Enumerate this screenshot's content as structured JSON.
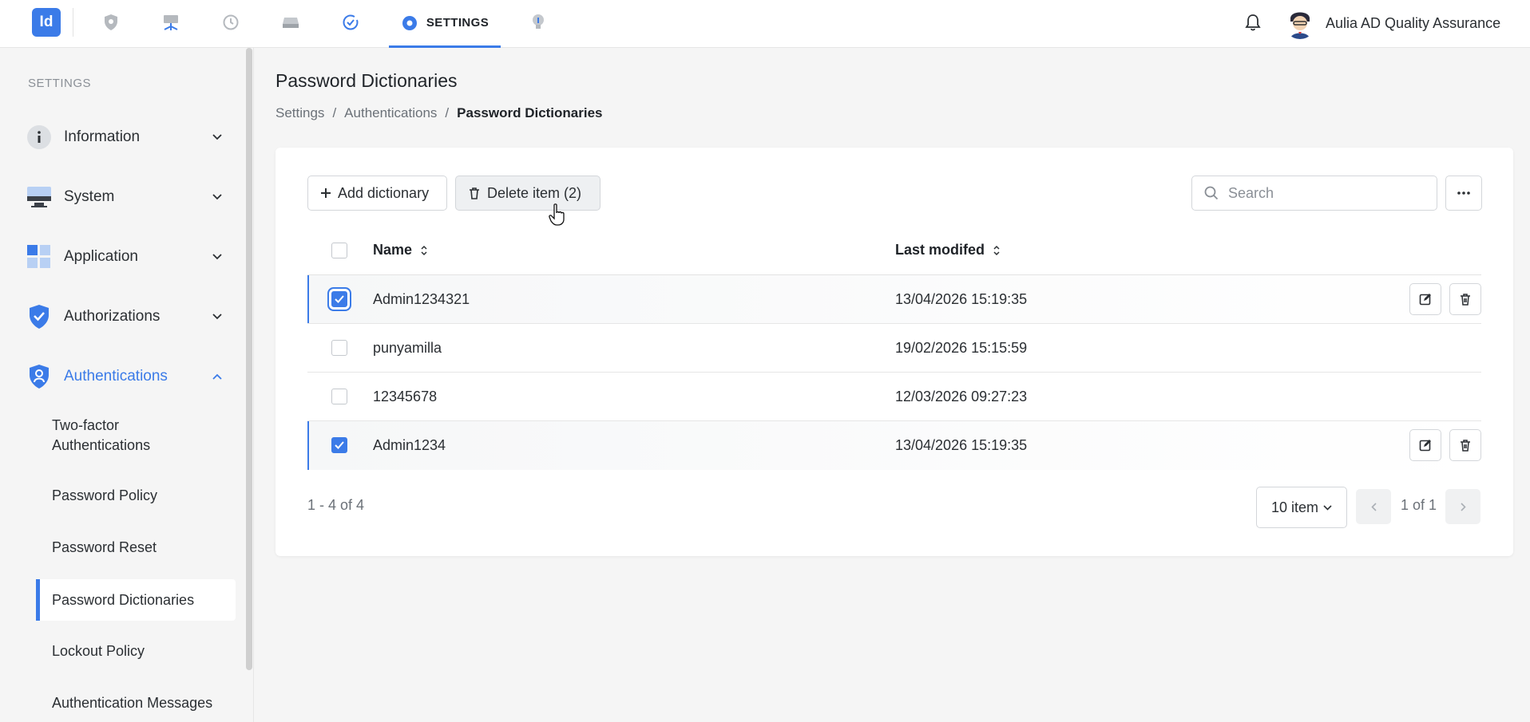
{
  "topbar": {
    "logo": "Id",
    "nav_active_label": "SETTINGS",
    "user_name": "Aulia AD Quality Assurance",
    "nav_icons": [
      "shield-icon",
      "network-icon",
      "history-icon",
      "storage-icon",
      "check-circle-icon",
      "settings-gear-icon",
      "bulb-icon"
    ]
  },
  "sidebar": {
    "title": "SETTINGS",
    "items": [
      {
        "label": "Information",
        "icon": "info-icon"
      },
      {
        "label": "System",
        "icon": "monitor-icon"
      },
      {
        "label": "Application",
        "icon": "grid-icon"
      },
      {
        "label": "Authorizations",
        "icon": "shield-check-icon"
      },
      {
        "label": "Authentications",
        "icon": "shield-user-icon",
        "active": true
      }
    ],
    "subitems": [
      {
        "label": "Two-factor Authentications"
      },
      {
        "label": "Password Policy"
      },
      {
        "label": "Password Reset"
      },
      {
        "label": "Password Dictionaries",
        "active": true
      },
      {
        "label": "Lockout Policy"
      },
      {
        "label": "Authentication Messages"
      }
    ]
  },
  "main": {
    "title": "Password Dictionaries",
    "breadcrumb": [
      "Settings",
      "Authentications",
      "Password Dictionaries"
    ],
    "toolbar": {
      "add_label": "Add dictionary",
      "delete_label": "Delete item (2)",
      "search_placeholder": "Search"
    },
    "table": {
      "columns": [
        "Name",
        "Last modifed"
      ],
      "rows": [
        {
          "name": "Admin1234321",
          "modified": "13/04/2026 15:19:35",
          "checked": true
        },
        {
          "name": "punyamilla",
          "modified": "19/02/2026 15:15:59",
          "checked": false
        },
        {
          "name": "12345678",
          "modified": "12/03/2026 09:27:23",
          "checked": false
        },
        {
          "name": "Admin1234",
          "modified": "13/04/2026 15:19:35",
          "checked": true
        }
      ]
    },
    "footer": {
      "count": "1 - 4 of 4",
      "page_size": "10 item",
      "page_info": "1 of 1"
    }
  },
  "colors": {
    "accent": "#3b7be8",
    "background": "#f5f5f5"
  }
}
